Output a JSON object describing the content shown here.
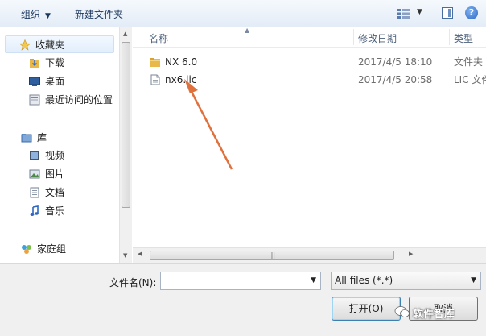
{
  "toolbar": {
    "organize": "组织",
    "new_folder": "新建文件夹",
    "help": "?"
  },
  "nav": {
    "favorites": "收藏夹",
    "downloads": "下载",
    "desktop": "桌面",
    "recent": "最近访问的位置",
    "libraries": "库",
    "videos": "视频",
    "pictures": "图片",
    "documents": "文档",
    "music": "音乐",
    "homegroup": "家庭组"
  },
  "columns": {
    "name": "名称",
    "modified": "修改日期",
    "type": "类型"
  },
  "files": [
    {
      "name": "NX 6.0",
      "date": "2017/4/5 18:10",
      "type": "文件夹",
      "icon": "folder-icon"
    },
    {
      "name": "nx6.lic",
      "date": "2017/4/5 20:58",
      "type": "LIC 文件",
      "icon": "file-icon"
    }
  ],
  "bottom": {
    "filename_label": "文件名(N):",
    "filename_value": "",
    "filetype_value": "All files (*.*)",
    "open_label": "打开(O)",
    "cancel_label": "取消"
  },
  "watermark": "软件智库",
  "colors": {
    "accent": "#1e3960",
    "annotation_arrow": "#e0703c",
    "folder": "#e8b84a"
  }
}
